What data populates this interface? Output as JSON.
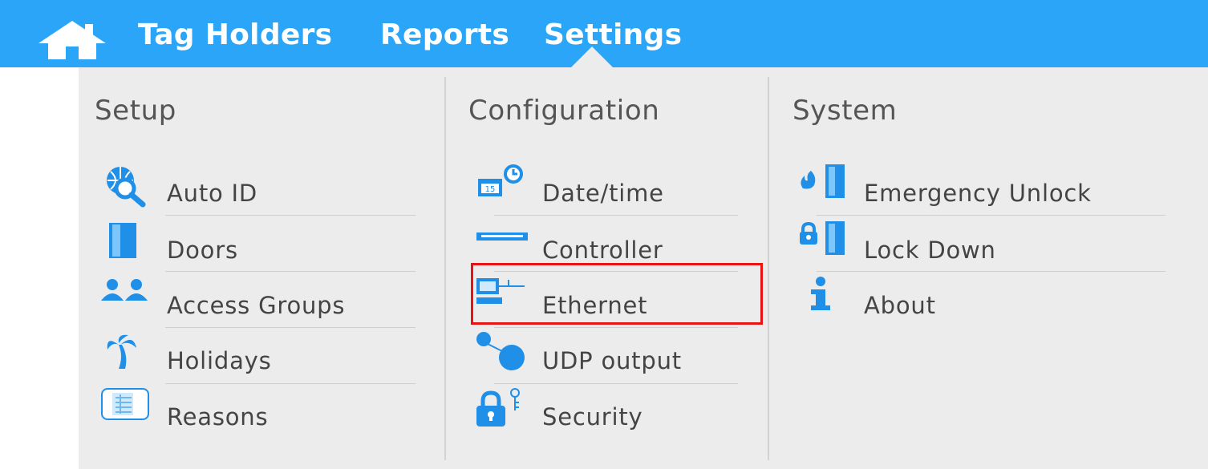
{
  "nav": {
    "items": [
      "Tag Holders",
      "Reports",
      "Settings"
    ],
    "active": "Settings"
  },
  "columns": {
    "setup": {
      "heading": "Setup",
      "items": [
        "Auto ID",
        "Doors",
        "Access Groups",
        "Holidays",
        "Reasons"
      ]
    },
    "configuration": {
      "heading": "Configuration",
      "items": [
        "Date/time",
        "Controller",
        "Ethernet",
        "UDP output",
        "Security"
      ]
    },
    "system": {
      "heading": "System",
      "items": [
        "Emergency Unlock",
        "Lock Down",
        "About"
      ]
    }
  },
  "highlighted_item": "Ethernet",
  "colors": {
    "accent": "#2aa5f8",
    "icon": "#1f8fe8",
    "panel": "#ececec",
    "highlight": "#e81414"
  }
}
